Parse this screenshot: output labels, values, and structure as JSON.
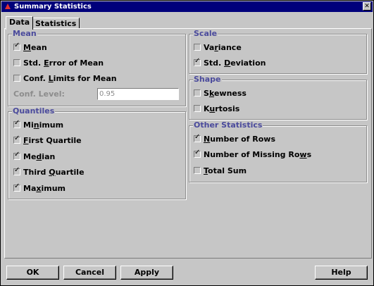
{
  "window": {
    "title": "Summary Statistics",
    "close_glyph": "✕"
  },
  "tabs": [
    {
      "label": "Data",
      "active": true
    },
    {
      "label": "Statistics",
      "active": false
    }
  ],
  "mean": {
    "legend": "Mean",
    "items": [
      {
        "pre": "",
        "u": "M",
        "post": "ean",
        "checked": true
      },
      {
        "pre": "Std. ",
        "u": "E",
        "post": "rror of Mean",
        "checked": false
      },
      {
        "pre": "Conf. ",
        "u": "L",
        "post": "imits for Mean",
        "checked": false
      }
    ],
    "conf_level_label": "Conf. Level:",
    "conf_level_value": "0.95"
  },
  "quantiles": {
    "legend": "Quantiles",
    "items": [
      {
        "pre": "Mi",
        "u": "n",
        "post": "imum",
        "checked": true
      },
      {
        "pre": "",
        "u": "F",
        "post": "irst Quartile",
        "checked": true
      },
      {
        "pre": "Me",
        "u": "d",
        "post": "ian",
        "checked": true
      },
      {
        "pre": "Third ",
        "u": "Q",
        "post": "uartile",
        "checked": true
      },
      {
        "pre": "Ma",
        "u": "x",
        "post": "imum",
        "checked": true
      }
    ]
  },
  "scale": {
    "legend": "Scale",
    "items": [
      {
        "pre": "Va",
        "u": "r",
        "post": "iance",
        "checked": false
      },
      {
        "pre": "Std. ",
        "u": "D",
        "post": "eviation",
        "checked": true
      }
    ]
  },
  "shape": {
    "legend": "Shape",
    "items": [
      {
        "pre": "S",
        "u": "k",
        "post": "ewness",
        "checked": false
      },
      {
        "pre": "K",
        "u": "u",
        "post": "rtosis",
        "checked": false
      }
    ]
  },
  "other": {
    "legend": "Other Statistics",
    "items": [
      {
        "pre": "",
        "u": "N",
        "post": "umber of Rows",
        "checked": true
      },
      {
        "pre": "Number of Missing Ro",
        "u": "w",
        "post": "s",
        "checked": true
      },
      {
        "pre": "",
        "u": "T",
        "post": "otal Sum",
        "checked": false
      }
    ]
  },
  "buttons": {
    "ok": "OK",
    "cancel": "Cancel",
    "apply": "Apply",
    "help": "Help"
  }
}
